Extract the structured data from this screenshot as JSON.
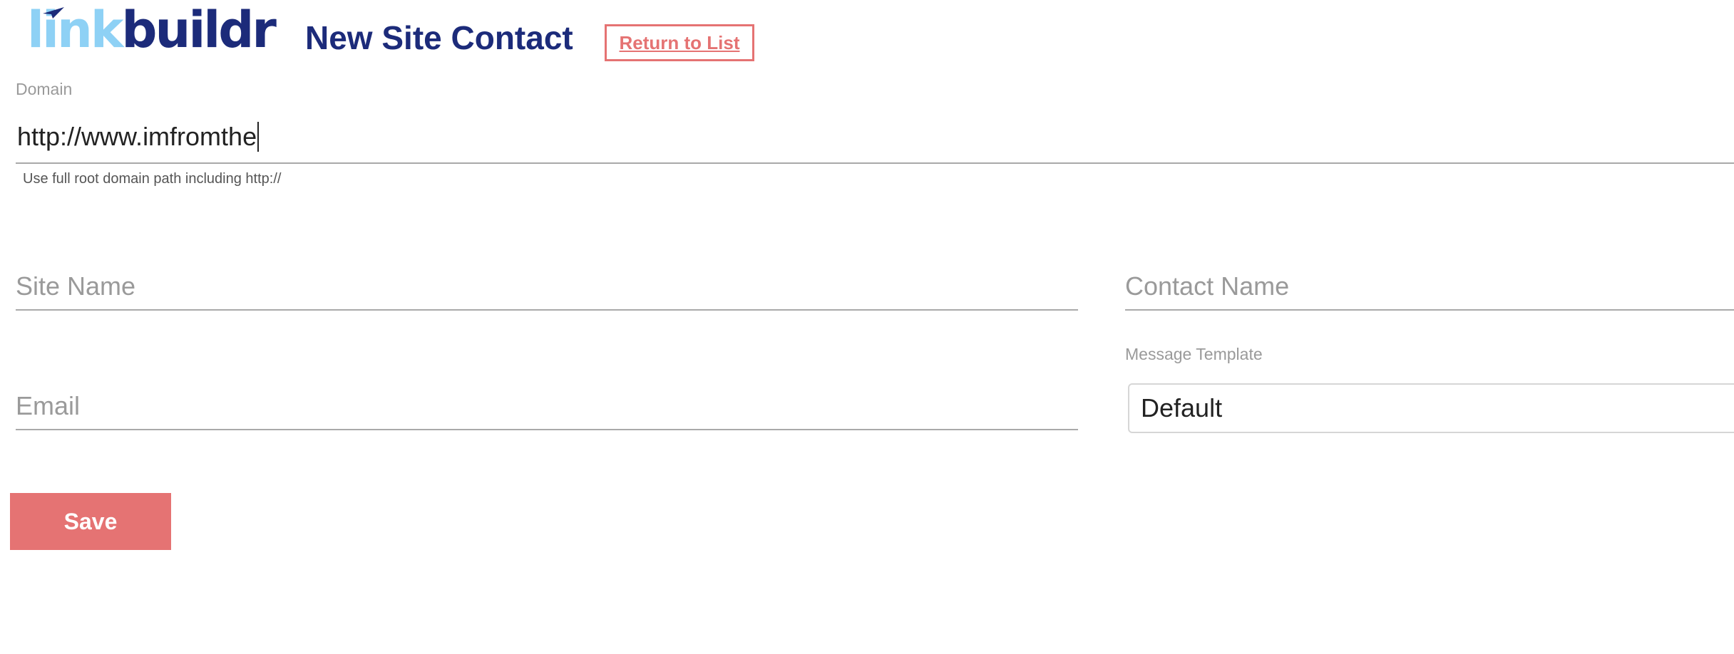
{
  "header": {
    "logo_light": "link",
    "logo_dark": "buildr",
    "title": "New Site Contact",
    "return_label": "Return to List"
  },
  "form": {
    "domain": {
      "label": "Domain",
      "value": "http://www.imfromthe",
      "helper": "Use full root domain path including http://"
    },
    "site_name": {
      "placeholder": "Site Name",
      "value": ""
    },
    "contact_name": {
      "placeholder": "Contact Name",
      "value": ""
    },
    "email": {
      "placeholder": "Email",
      "value": ""
    },
    "message_template": {
      "label": "Message Template",
      "selected": "Default"
    },
    "save_label": "Save"
  },
  "colors": {
    "brand_dark": "#1c2b7a",
    "brand_light": "#8ed1f5",
    "accent": "#e57373"
  },
  "icons": {
    "logo_plane": "paper-plane-icon"
  }
}
